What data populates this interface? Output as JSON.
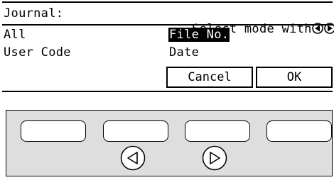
{
  "header": {
    "title": "Journal:",
    "instruction": "Select mode with"
  },
  "options_left": [
    {
      "label": "All"
    },
    {
      "label": "User Code"
    }
  ],
  "options_right": [
    {
      "label": "File No.",
      "selected": true
    },
    {
      "label": "Date",
      "selected": false
    }
  ],
  "buttons": {
    "cancel": "Cancel",
    "ok": "OK"
  },
  "icons": {
    "left": "left-arrow-icon",
    "right": "right-arrow-icon"
  }
}
